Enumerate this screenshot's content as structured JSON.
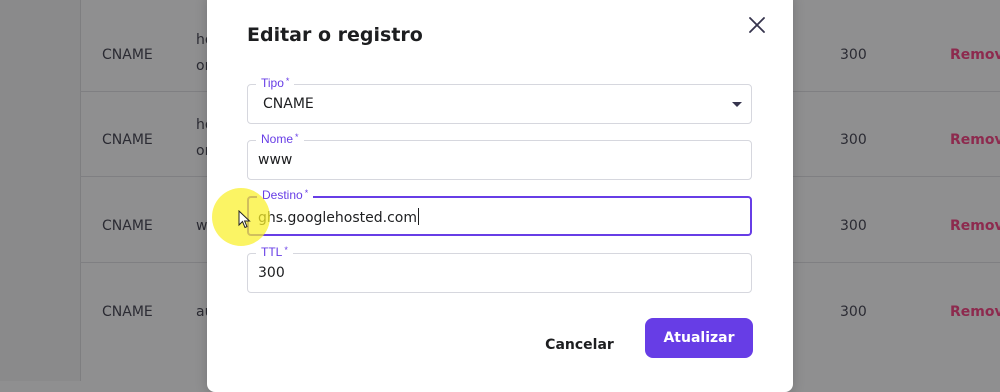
{
  "background_table": {
    "rows": [
      {
        "type": "CNAME",
        "name": "ho\nor",
        "ttl": "300",
        "action": "Remove"
      },
      {
        "type": "CNAME",
        "name": "ho\nor",
        "ttl": "300",
        "action": "Remove"
      },
      {
        "type": "CNAME",
        "name": "w",
        "ttl": "300",
        "action": "Remove"
      },
      {
        "type": "CNAME",
        "name": "au",
        "ttl": "300",
        "action": "Remove"
      }
    ]
  },
  "modal": {
    "title": "Editar o registro",
    "close_icon": "close-icon",
    "fields": {
      "tipo": {
        "label": "Tipo",
        "value": "CNAME"
      },
      "nome": {
        "label": "Nome",
        "value": "www"
      },
      "destino": {
        "label": "Destino",
        "value": "ghs.googlehosted.com"
      },
      "ttl": {
        "label": "TTL",
        "value": "300"
      }
    },
    "required_marker": "*",
    "cancel_label": "Cancelar",
    "update_label": "Atualizar"
  },
  "colors": {
    "accent": "#673de6",
    "remove_text": "#8d2a4e",
    "overlay": "#8f8f90"
  }
}
